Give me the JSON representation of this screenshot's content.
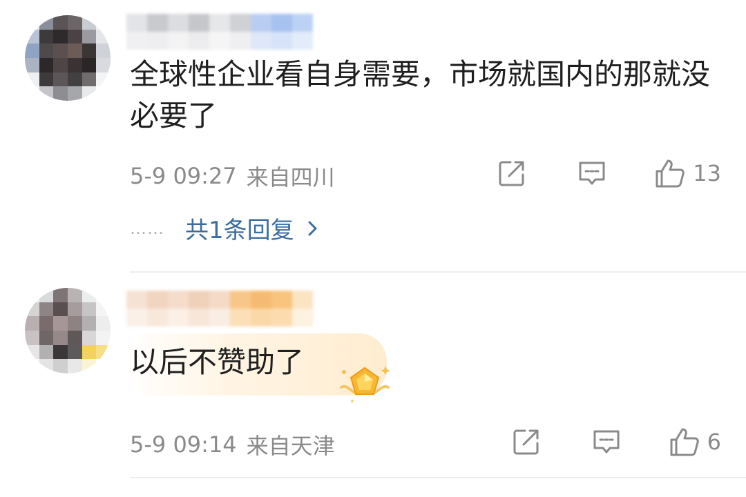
{
  "comments": [
    {
      "text": "全球性企业看自身需要，市场就国内的那就没必要了",
      "time": "5-9 09:27",
      "location": "来自四川",
      "likes": "13",
      "replies_label": "共1条回复",
      "replies_prefix": "……"
    },
    {
      "text": "以后不赞助了",
      "time": "5-9 09:14",
      "location": "来自天津",
      "likes": "6"
    }
  ],
  "icons": {
    "share": "share-icon",
    "reply": "comment-icon",
    "like": "thumbs-up-icon",
    "chevron": "chevron-right-icon",
    "badge": "pentagon-badge-icon"
  },
  "colors": {
    "text": "#1f1f1f",
    "meta": "#8a8a8a",
    "link": "#3d6c9f",
    "divider": "#eeeeee"
  }
}
